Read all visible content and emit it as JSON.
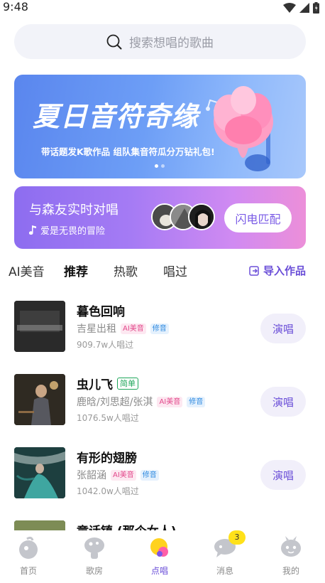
{
  "status": {
    "time": "9:48"
  },
  "search": {
    "placeholder": "搜索想唱的歌曲"
  },
  "banner": {
    "title": "夏日音符奇缘",
    "subtitle": "带话题发K歌作品 组队集音符瓜分万钻礼包!",
    "page_count": 2,
    "active_page": 1
  },
  "match": {
    "title": "与森友实时对唱",
    "song": "爱是无畏的冒险",
    "button_label": "闪电匹配"
  },
  "tabs": {
    "items": [
      "AI美音",
      "推荐",
      "热歌",
      "唱过"
    ],
    "active": "推荐",
    "import_label": "导入作品"
  },
  "songs": [
    {
      "title": "暮色回响",
      "badge": "",
      "artist": "吉星出租",
      "tags": [
        "AI美音",
        "修音"
      ],
      "count": "909.7w人唱过",
      "button": "演唱"
    },
    {
      "title": "虫儿飞",
      "badge": "简单",
      "artist": "鹿晗/刘思超/张淇",
      "tags": [
        "AI美音",
        "修音"
      ],
      "count": "1076.5w人唱过",
      "button": "演唱"
    },
    {
      "title": "有形的翅膀",
      "badge": "",
      "artist": "张韶涵",
      "tags": [
        "AI美音",
        "修音"
      ],
      "count": "1042.0w人唱过",
      "button": "演唱"
    },
    {
      "title": "童话镇 (那个女人)",
      "badge": "",
      "artist": "",
      "tags": [],
      "count": "",
      "button": ""
    }
  ],
  "nav": {
    "items": [
      {
        "label": "首页",
        "icon": "home-icon"
      },
      {
        "label": "歌房",
        "icon": "room-icon"
      },
      {
        "label": "点唱",
        "icon": "sing-icon"
      },
      {
        "label": "消息",
        "icon": "message-icon"
      },
      {
        "label": "我的",
        "icon": "profile-icon"
      }
    ],
    "active": "点唱",
    "message_badge": "3"
  },
  "colors": {
    "accent": "#6b4fd8",
    "tab_highlight": "#ffdb2e",
    "ai_tag": "#e2478a",
    "fix_tag": "#2f8ae0"
  }
}
